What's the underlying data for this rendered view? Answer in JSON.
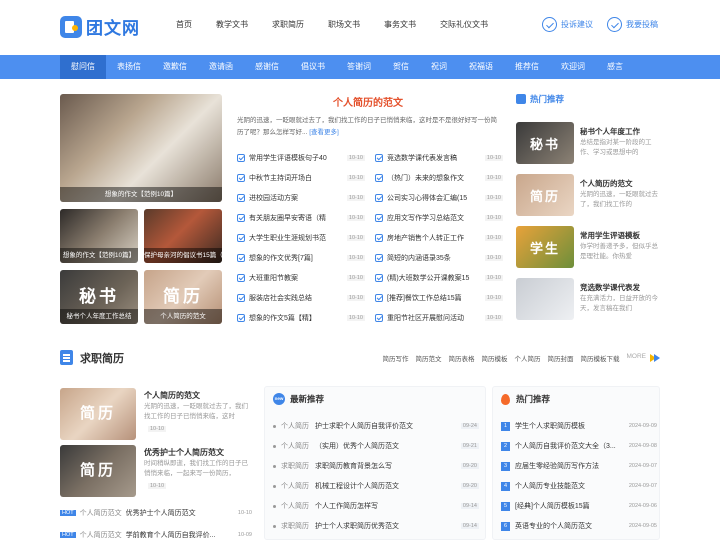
{
  "header": {
    "logo_text": "团文网",
    "nav": [
      "首页",
      "教学文书",
      "求职简历",
      "职场文书",
      "事务文书",
      "交际礼仪文书"
    ],
    "actions": [
      "投诉建议",
      "我要投稿"
    ]
  },
  "category_bar": {
    "items": [
      "慰问信",
      "表扬信",
      "邀歉信",
      "邀请函",
      "感谢信",
      "倡议书",
      "答谢词",
      "贺信",
      "祝词",
      "祝福语",
      "推荐信",
      "欢迎词",
      "感言"
    ],
    "active_index": 0
  },
  "feature": {
    "main_caption": "想象的作文【范例10篇】",
    "thumbs": [
      {
        "caption": "想象的作文【范例10篇】",
        "big": ""
      },
      {
        "caption": "保护母亲河的倡议书15篇（精",
        "big": ""
      },
      {
        "caption": "秘书个人年度工作总结",
        "big": "秘书"
      },
      {
        "caption": "个人简历的范文",
        "big": "简历"
      }
    ]
  },
  "article": {
    "title": "个人简历的范文",
    "desc": "光阴的迅速，一眨眼就过去了，我们找工作的日子已悄悄来临，这时是不是很好好写一份简历了呢？那么怎样写好...",
    "more": "[查看更多]"
  },
  "links_left": [
    {
      "t": "常用学生评语模板句子40",
      "d": "10-10"
    },
    {
      "t": "中秋节主持词开场白",
      "d": "10-10"
    },
    {
      "t": "进校园活动方案",
      "d": "10-10"
    },
    {
      "t": "有关朋友圈早安寄语（精",
      "d": "10-10"
    },
    {
      "t": "大学生职业生涯规划书范",
      "d": "10-10"
    },
    {
      "t": "想象的作文优秀[7篇]",
      "d": "10-10"
    },
    {
      "t": "大班重阳节教案",
      "d": "10-10"
    },
    {
      "t": "服装店社会实践总结",
      "d": "10-10"
    },
    {
      "t": "想象的作文5篇【精】",
      "d": "10-10"
    }
  ],
  "links_right": [
    {
      "t": "竞选数学课代表发言稿",
      "d": "10-10"
    },
    {
      "t": "（热门）未来的想象作文",
      "d": "10-10"
    },
    {
      "t": "公司实习心得体会汇编(15",
      "d": "10-10"
    },
    {
      "t": "应用文写作学习总结范文",
      "d": "10-10"
    },
    {
      "t": "房地产销售个人转正工作",
      "d": "10-10"
    },
    {
      "t": "简短的内涵语录35条",
      "d": "10-10"
    },
    {
      "t": "(精)大班数学公开课教案15",
      "d": "10-10"
    },
    {
      "t": "[推荐]餐饮工作总结15篇",
      "d": "10-10"
    },
    {
      "t": "重阳节社区开展慰问活动",
      "d": "10-10"
    }
  ],
  "hot_recommend": {
    "title": "热门推荐",
    "items": [
      {
        "t": "秘书个人年度工作",
        "d": "总结是指对某一阶段的工作、学习或思想中的",
        "big": "秘书"
      },
      {
        "t": "个人简历的范文",
        "d": "光阴的迅速，一眨眼就过去了，我们找工作的",
        "big": "简历"
      },
      {
        "t": "常用学生评语模板",
        "d": "你学时善递予多，但似乎总是理社能。你热爱",
        "big": "学生"
      },
      {
        "t": "竞选数学课代表发",
        "d": "在充满活力，日益开放的今天，发言稿在我们",
        "big": ""
      }
    ]
  },
  "resume_section": {
    "title": "求职简历",
    "tags": [
      "简历写作",
      "简历范文",
      "简历表格",
      "简历模板",
      "个人简历",
      "简历封面",
      "简历模板下载",
      "MORE"
    ],
    "featured": [
      {
        "t": "个人简历的范文",
        "d": "光阴的迅速，一眨眼就过去了，我们找工作的日子已悄悄来临，这时",
        "date": "10-10",
        "big": "简历"
      },
      {
        "t": "优秀护士个人简历范文",
        "d": "时间稍纵即逝，我们找工作的日子已悄悄来临，一起来写一份简历，",
        "date": "10-10",
        "big": "简历"
      }
    ],
    "hot_list": [
      {
        "badge": "HOT",
        "c": "个人简历范文",
        "t": "优秀护士个人简历范文",
        "d": "10-10"
      },
      {
        "badge": "HOT",
        "c": "个人简历范文",
        "t": "学前教育个人简历自我评价...",
        "d": "10-09"
      }
    ]
  },
  "latest": {
    "title": "最新推荐",
    "badge": "new",
    "rows": [
      {
        "c": "个人简历",
        "t": "护士求职个人简历自我评价范文",
        "d": "09-24"
      },
      {
        "c": "个人简历",
        "t": "（实用）优秀个人简历范文",
        "d": "09-21"
      },
      {
        "c": "求职简历",
        "t": "求职简历教育背景怎么写",
        "d": "09-20"
      },
      {
        "c": "个人简历",
        "t": "机械工程设计个人简历范文",
        "d": "09-20"
      },
      {
        "c": "个人简历",
        "t": "个人工作简历怎样写",
        "d": "09-14"
      },
      {
        "c": "求职简历",
        "t": "护士个人求职简历优秀范文",
        "d": "09-14"
      }
    ]
  },
  "hot_rank": {
    "title": "热门推荐",
    "rows": [
      {
        "n": "1",
        "t": "学生个人求职简历模板",
        "d": "2024-09-09"
      },
      {
        "n": "2",
        "t": "个人简历自我评价范文大全（3...",
        "d": "2024-09-08"
      },
      {
        "n": "3",
        "t": "应届生零经验简历写作方法",
        "d": "2024-09-07"
      },
      {
        "n": "4",
        "t": "个人简历专业技能范文",
        "d": "2024-09-07"
      },
      {
        "n": "5",
        "t": "[经典]个人简历模板15篇",
        "d": "2024-09-06"
      },
      {
        "n": "6",
        "t": "英语专业的个人简历范文",
        "d": "2024-09-05"
      }
    ]
  }
}
